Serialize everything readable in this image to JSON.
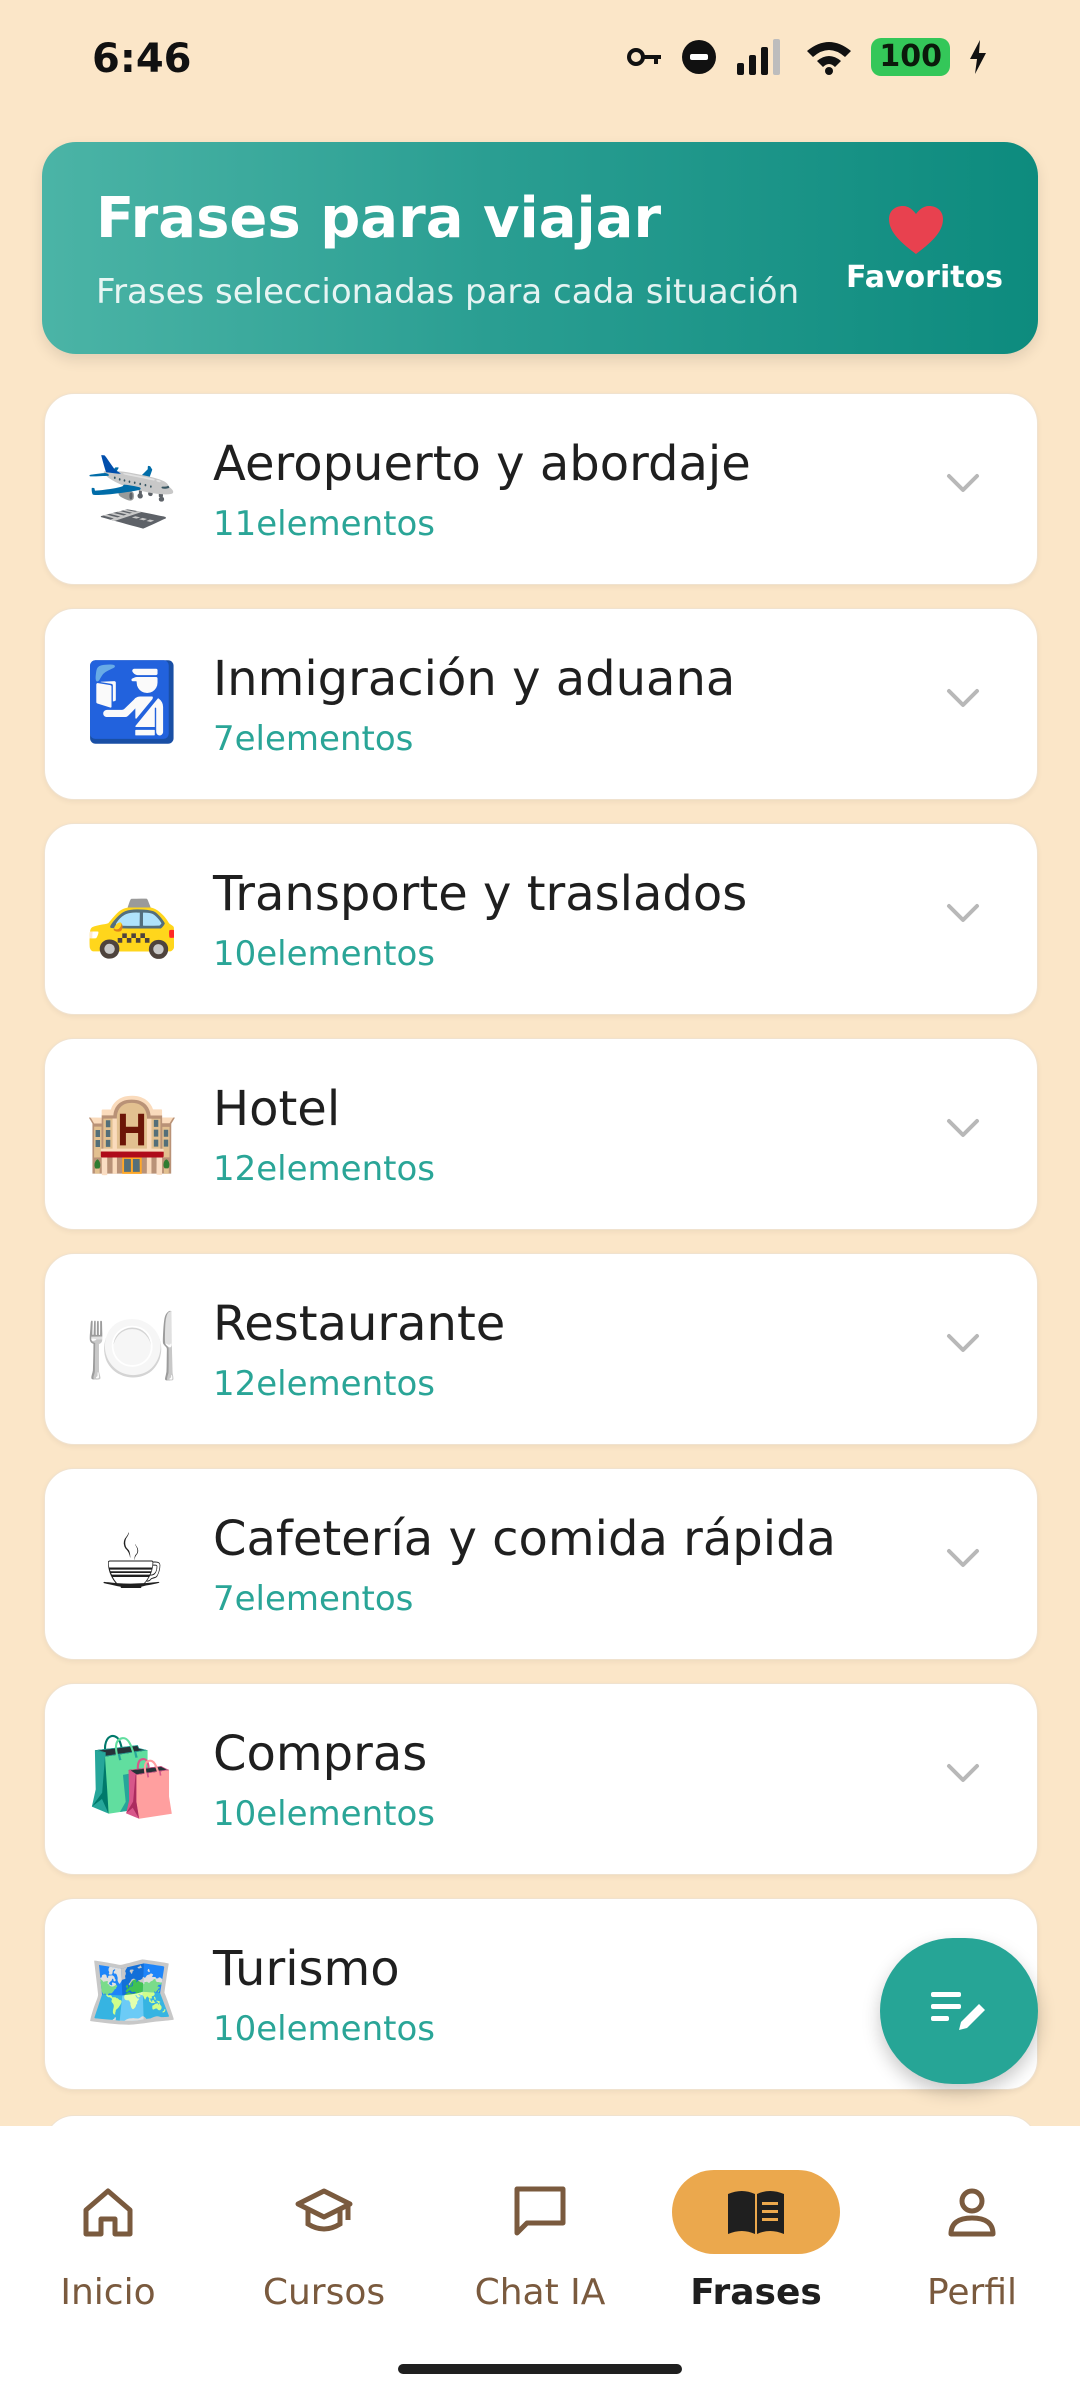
{
  "status_bar": {
    "time": "6:46",
    "battery": "100",
    "icons": [
      "key-icon",
      "do-not-disturb-icon",
      "signal-icon",
      "wifi-icon",
      "battery-icon",
      "charging-icon"
    ]
  },
  "header": {
    "title": "Frases para viajar",
    "subtitle": "Frases seleccionadas para cada situación",
    "favorites_label": "Favoritos",
    "favorites_icon": "heart-icon"
  },
  "categories": [
    {
      "emoji": "🛬",
      "icon": "airplane-icon",
      "title": "Aeropuerto y abordaje",
      "count": "11elementos"
    },
    {
      "emoji": "🛂",
      "icon": "passport-control-icon",
      "title": "Inmigración y aduana",
      "count": "7elementos"
    },
    {
      "emoji": "🚕",
      "icon": "taxi-icon",
      "title": "Transporte y traslados",
      "count": "10elementos"
    },
    {
      "emoji": "🏨",
      "icon": "hotel-icon",
      "title": "Hotel",
      "count": "12elementos"
    },
    {
      "emoji": "🍽️",
      "icon": "plate-icon",
      "title": "Restaurante",
      "count": "12elementos"
    },
    {
      "emoji": "☕",
      "icon": "coffee-icon",
      "title": "Cafetería y comida rápida",
      "count": "7elementos"
    },
    {
      "emoji": "🛍️",
      "icon": "shopping-bags-icon",
      "title": "Compras",
      "count": "10elementos"
    },
    {
      "emoji": "🗺️",
      "icon": "map-icon",
      "title": "Turismo",
      "count": "10elementos"
    }
  ],
  "fab": {
    "icon": "edit-note-icon"
  },
  "bottom_nav": {
    "items": [
      {
        "label": "Inicio",
        "icon": "home-icon",
        "active": false
      },
      {
        "label": "Cursos",
        "icon": "school-icon",
        "active": false
      },
      {
        "label": "Chat IA",
        "icon": "chat-bubble-icon",
        "active": false
      },
      {
        "label": "Frases",
        "icon": "book-icon",
        "active": true
      },
      {
        "label": "Perfil",
        "icon": "person-icon",
        "active": false
      }
    ]
  },
  "colors": {
    "background": "#fbe6c8",
    "accent_teal": "#26a596",
    "active_nav": "#eba84d",
    "heart": "#e8414f"
  }
}
